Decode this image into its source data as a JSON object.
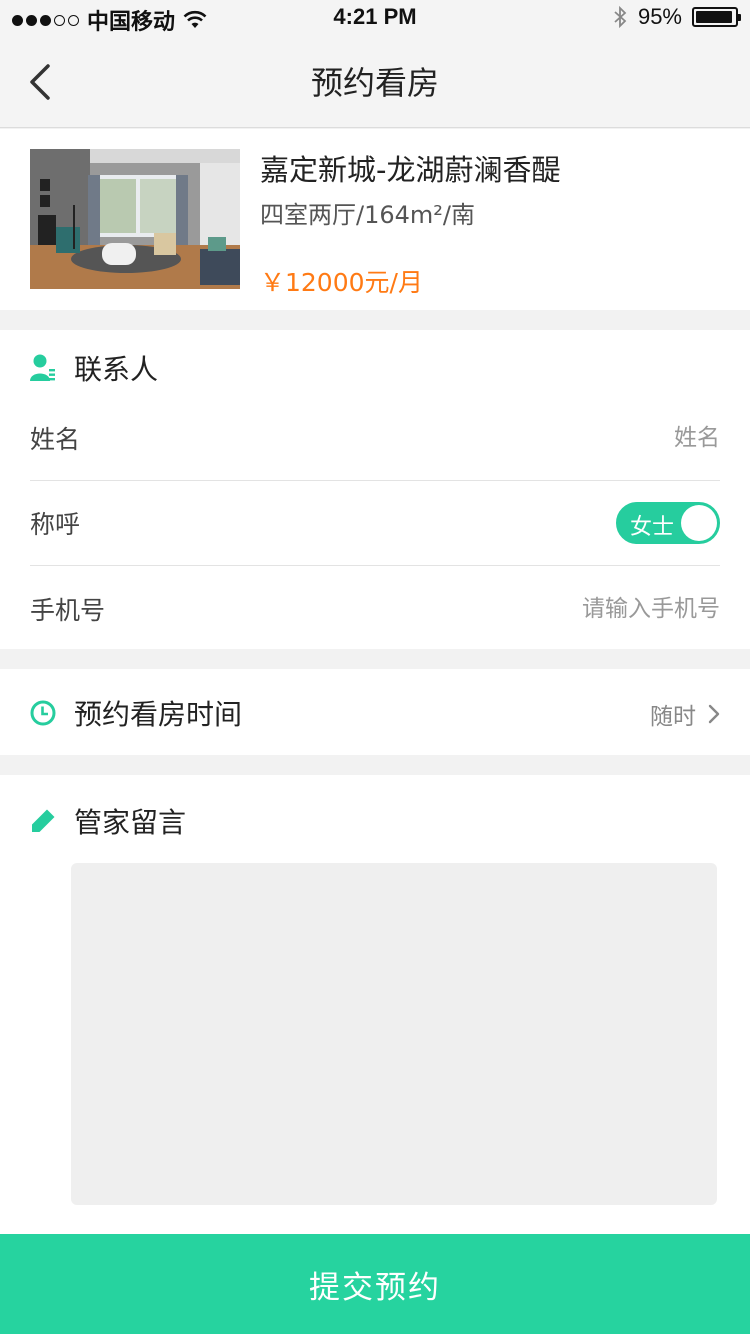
{
  "status_bar": {
    "carrier": "中国移动",
    "time": "4:21 PM",
    "battery": "95%",
    "battery_level": 0.95
  },
  "nav": {
    "title": "预约看房",
    "back_icon": "chevron-left-icon"
  },
  "listing": {
    "title": "嘉定新城-龙湖蔚澜香醍",
    "details": "四室两厅/164m²/南",
    "price": "￥12000元/月"
  },
  "contact": {
    "heading": "联系人",
    "name_label": "姓名",
    "name_placeholder": "姓名",
    "salutation_label": "称呼",
    "salutation_value": "女士",
    "phone_label": "手机号",
    "phone_placeholder": "请输入手机号"
  },
  "viewing_time": {
    "heading": "预约看房时间",
    "value": "随时"
  },
  "message": {
    "heading": "管家留言",
    "text": ""
  },
  "submit": {
    "label": "提交预约"
  },
  "colors": {
    "accent": "#26d39f",
    "price": "#ff7a14",
    "background": "#f2f2f2"
  }
}
